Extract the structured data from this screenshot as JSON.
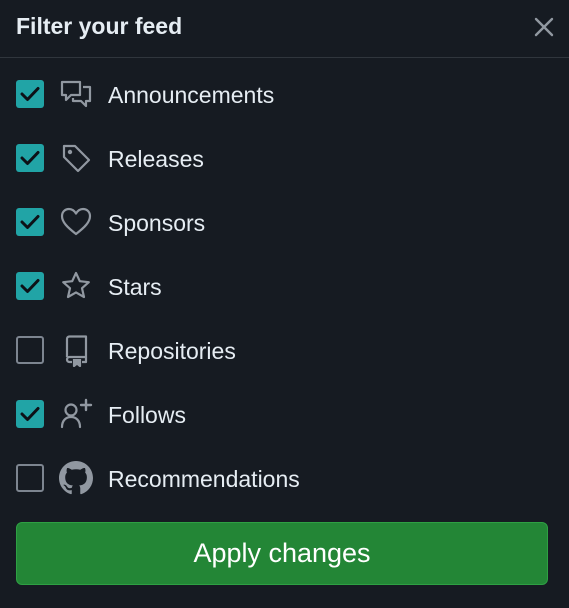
{
  "dialog": {
    "title": "Filter your feed",
    "close_icon": "x-icon"
  },
  "items": [
    {
      "label": "Announcements",
      "checked": true,
      "icon": "comment-discussion-icon"
    },
    {
      "label": "Releases",
      "checked": true,
      "icon": "tag-icon"
    },
    {
      "label": "Sponsors",
      "checked": true,
      "icon": "heart-icon"
    },
    {
      "label": "Stars",
      "checked": true,
      "icon": "star-icon"
    },
    {
      "label": "Repositories",
      "checked": false,
      "icon": "repo-icon"
    },
    {
      "label": "Follows",
      "checked": true,
      "icon": "person-add-icon"
    },
    {
      "label": "Recommendations",
      "checked": false,
      "icon": "github-mark-icon"
    }
  ],
  "apply_label": "Apply changes",
  "colors": {
    "background": "#161b22",
    "checkbox_checked": "#21a4a6",
    "button": "#238636",
    "text": "#e6edf3",
    "icon": "#9198a1"
  }
}
